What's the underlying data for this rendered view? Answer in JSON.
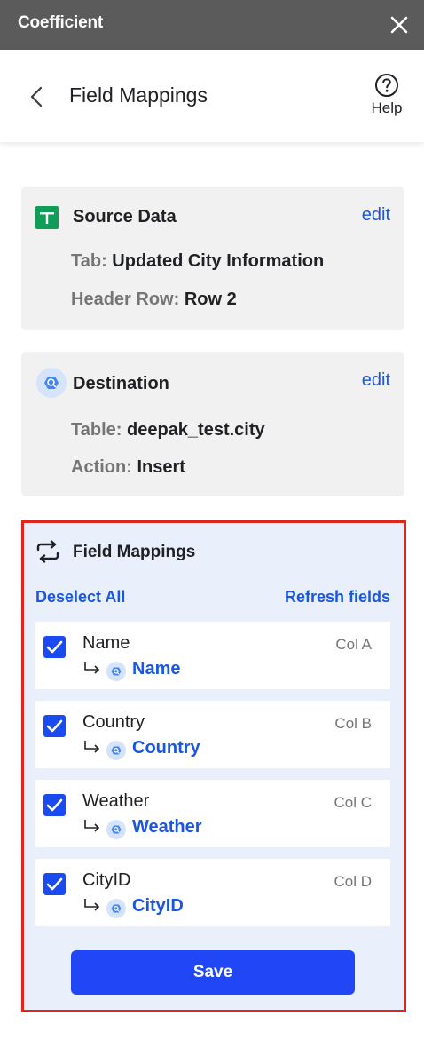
{
  "app": {
    "title": "Coefficient"
  },
  "header": {
    "title": "Field Mappings",
    "help_label": "Help"
  },
  "source_card": {
    "title": "Source Data",
    "edit_label": "edit",
    "tab_key": "Tab:",
    "tab_value": "Updated City Information",
    "header_row_key": "Header Row:",
    "header_row_value": "Row 2"
  },
  "destination_card": {
    "title": "Destination",
    "edit_label": "edit",
    "table_key": "Table:",
    "table_value": "deepak_test.city",
    "action_key": "Action:",
    "action_value": "Insert"
  },
  "field_mappings": {
    "title": "Field Mappings",
    "deselect_all_label": "Deselect All",
    "refresh_label": "Refresh fields",
    "save_label": "Save",
    "rows": [
      {
        "name": "Name",
        "column": "Col A",
        "destination": "Name",
        "checked": true
      },
      {
        "name": "Country",
        "column": "Col B",
        "destination": "Country",
        "checked": true
      },
      {
        "name": "Weather",
        "column": "Col C",
        "destination": "Weather",
        "checked": true
      },
      {
        "name": "CityID",
        "column": "Col D",
        "destination": "CityID",
        "checked": true
      }
    ]
  },
  "colors": {
    "titlebar": "#5b5b5b",
    "accent_blue": "#1a56e0",
    "checkbox_blue": "#1a4bf0",
    "save_button": "#2146f5",
    "highlight_border": "#e0261c",
    "panel_bg": "#e9f0fb",
    "card_bg": "#f1f1f1"
  },
  "icons": {
    "close": "close-icon",
    "back": "chevron-left-icon",
    "help": "help-circle-icon",
    "sheets": "google-sheets-icon",
    "bigquery": "bigquery-icon",
    "mapping": "sync-arrows-icon",
    "row_arrow": "subdirectory-arrow-icon",
    "checkbox": "checkbox-checked-icon"
  }
}
